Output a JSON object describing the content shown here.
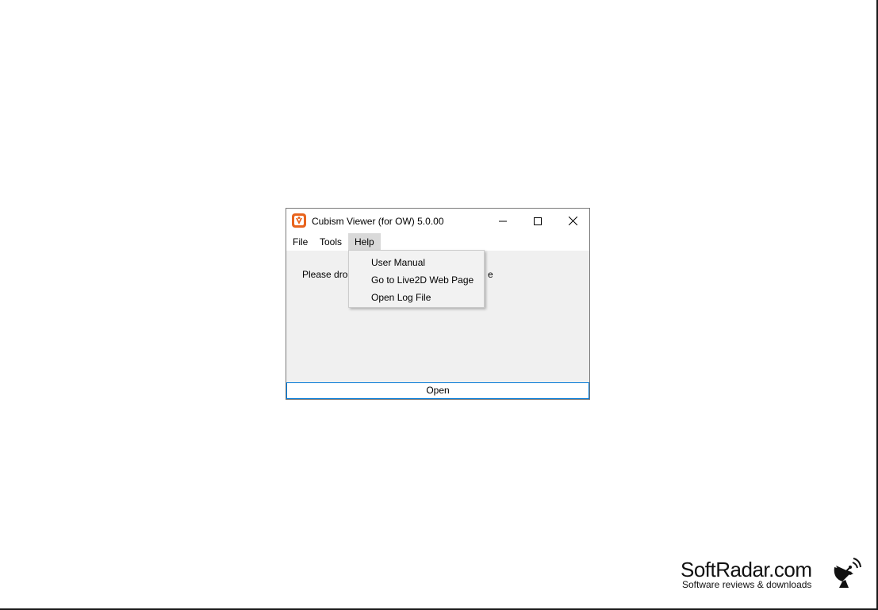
{
  "window": {
    "title": "Cubism Viewer (for OW) 5.0.00",
    "app_icon_color": "#e8641e",
    "menu": {
      "file": "File",
      "tools": "Tools",
      "help": "Help"
    },
    "content": {
      "drop_text_left": "Please drop",
      "drop_text_right": "e"
    },
    "open_button": "Open"
  },
  "help_menu": {
    "items": [
      {
        "label": "User Manual"
      },
      {
        "label": "Go to Live2D Web Page"
      },
      {
        "label": "Open Log File"
      }
    ]
  },
  "watermark": {
    "main": "SoftRadar.com",
    "sub": "Software reviews & downloads",
    "icon": "satellite-dish-icon"
  },
  "colors": {
    "accent": "#0078d7",
    "menu_highlight": "#d9d9d9"
  }
}
